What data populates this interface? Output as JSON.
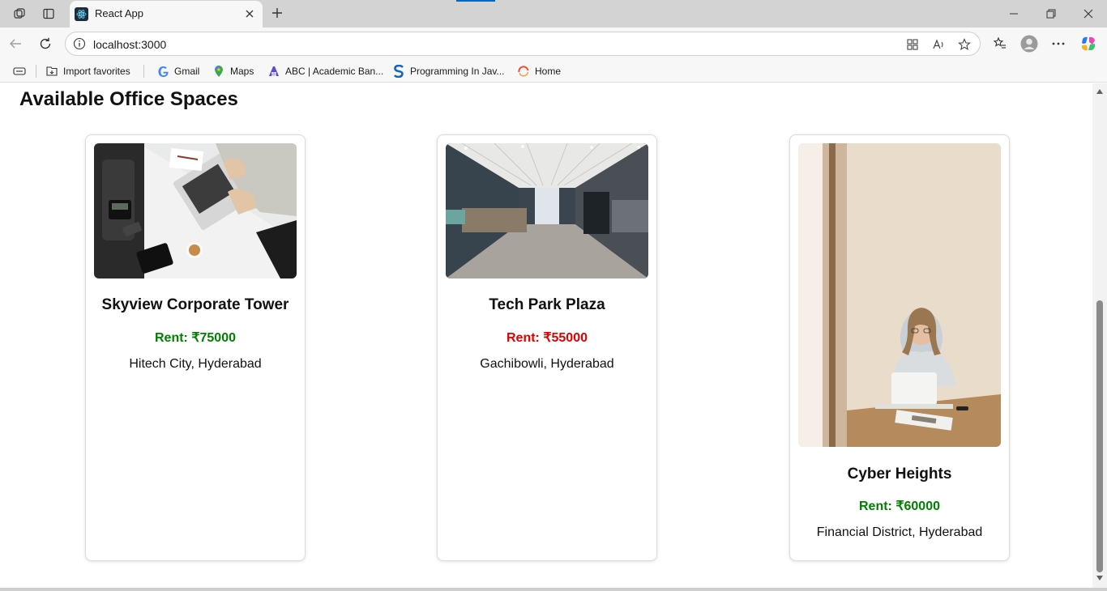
{
  "browser": {
    "tab_title": "React App",
    "url": "localhost:3000",
    "favorites": [
      {
        "label": "Import favorites",
        "icon": "import-favorites-icon"
      },
      {
        "label": "Gmail",
        "icon": "google-icon"
      },
      {
        "label": "Maps",
        "icon": "maps-pin-icon"
      },
      {
        "label": "ABC | Academic Ban...",
        "icon": "abc-icon"
      },
      {
        "label": "Programming In Jav...",
        "icon": "s-logo-icon"
      },
      {
        "label": "Home",
        "icon": "home-ring-icon"
      }
    ]
  },
  "page": {
    "title": "Available Office Spaces",
    "offices": [
      {
        "name": "Skyview Corporate Tower",
        "rent": "Rent: ₹75000",
        "rent_color": "#008000",
        "location": "Hitech City, Hyderabad",
        "image": "office-desk-laptop-photo"
      },
      {
        "name": "Tech Park Plaza",
        "rent": "Rent: ₹55000",
        "rent_color": "#e00000",
        "location": "Gachibowli, Hyderabad",
        "image": "office-corridor-photo"
      },
      {
        "name": "Cyber Heights",
        "rent": "Rent: ₹60000",
        "rent_color": "#008000",
        "location": "Financial District, Hyderabad",
        "image": "woman-laptop-photo"
      }
    ]
  },
  "colors": {
    "rent_green": "#008000",
    "rent_red": "#e00000",
    "browser_chrome": "#d3d3d3"
  }
}
